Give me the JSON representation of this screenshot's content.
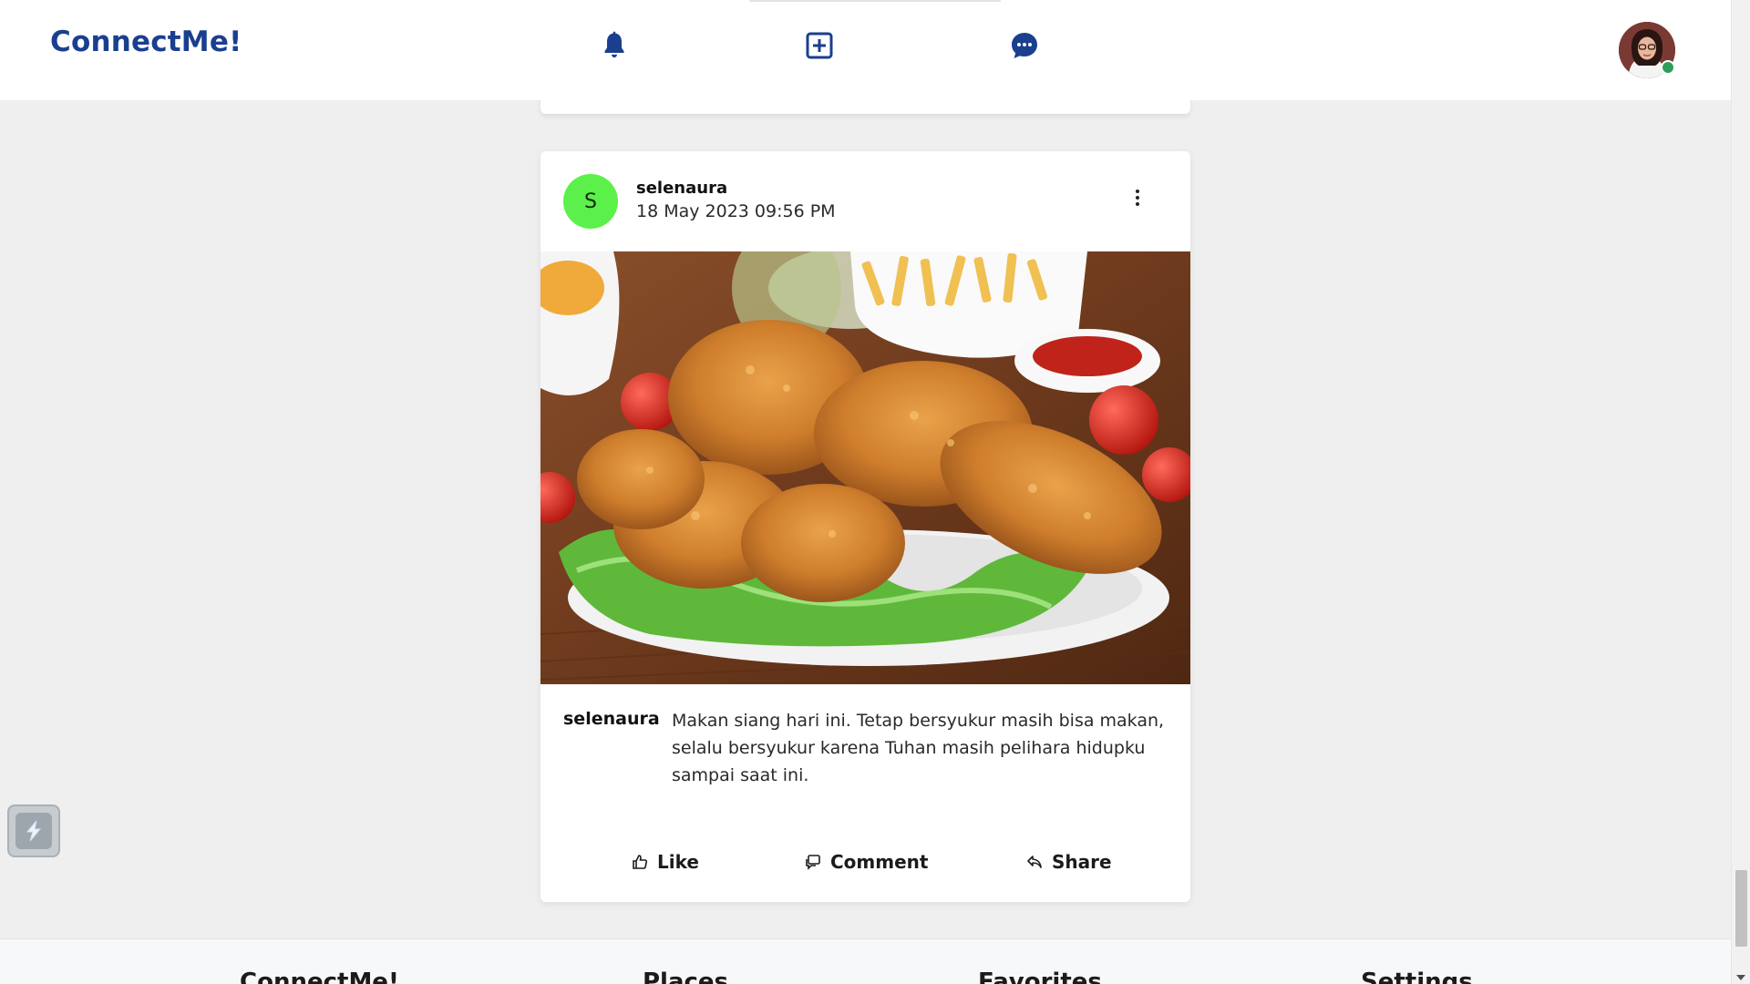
{
  "header": {
    "brand": "ConnectMe!",
    "icons": [
      "bell-icon",
      "plus-square-icon",
      "chat-bubble-icon"
    ],
    "accent_color": "#1b3f8f",
    "online_color": "#2e9e5b"
  },
  "post": {
    "username": "selenaura",
    "avatar_letter": "S",
    "avatar_color": "#5cf04a",
    "timestamp": "18 May 2023 09:56 PM",
    "caption_user": "selenaura",
    "caption": "Makan siang hari ini. Tetap bersyukur masih bisa makan, selalu bersyukur karena Tuhan masih pelihara hidupku sampai saat ini.",
    "actions": {
      "like": "Like",
      "comment": "Comment",
      "share": "Share"
    }
  },
  "footer": {
    "columns": [
      "ConnectMe!",
      "Places",
      "Favorites",
      "Settings"
    ]
  }
}
